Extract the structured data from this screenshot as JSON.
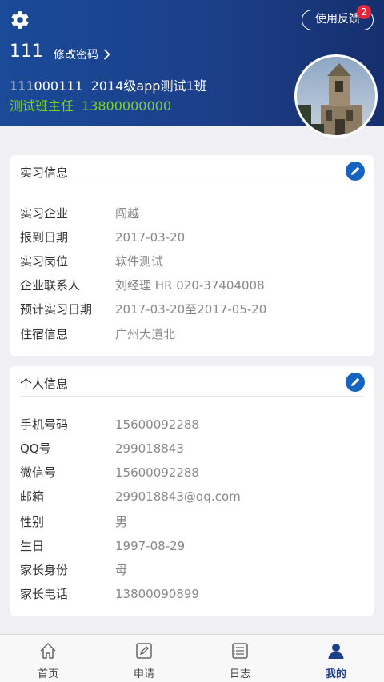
{
  "header": {
    "username": "111",
    "change_password": "修改密码",
    "feedback_label": "使用反馈",
    "feedback_badge": "2",
    "student_id": "111000111",
    "class_name": "2014级app测试1班",
    "teacher_title": "测试班主任",
    "teacher_phone": "13800000000"
  },
  "internship": {
    "title": "实习信息",
    "rows": [
      {
        "label": "实习企业",
        "value": "闯越"
      },
      {
        "label": "报到日期",
        "value": "2017-03-20"
      },
      {
        "label": "实习岗位",
        "value": "软件测试"
      },
      {
        "label": "企业联系人",
        "value": "刘经理 HR 020-37404008"
      },
      {
        "label": "预计实习日期",
        "value": "2017-03-20至2017-05-20"
      },
      {
        "label": "住宿信息",
        "value": "广州大道北"
      }
    ]
  },
  "personal": {
    "title": "个人信息",
    "rows": [
      {
        "label": "手机号码",
        "value": "15600092288"
      },
      {
        "label": "QQ号",
        "value": "299018843"
      },
      {
        "label": "微信号",
        "value": "15600092288"
      },
      {
        "label": "邮箱",
        "value": "299018843@qq.com"
      },
      {
        "label": "性别",
        "value": "男"
      },
      {
        "label": "生日",
        "value": "1997-08-29"
      },
      {
        "label": "家长身份",
        "value": "母"
      },
      {
        "label": "家长电话",
        "value": "13800090899"
      }
    ]
  },
  "tabs": [
    {
      "label": "首页",
      "icon": "home-icon"
    },
    {
      "label": "申请",
      "icon": "edit-doc-icon"
    },
    {
      "label": "日志",
      "icon": "log-icon"
    },
    {
      "label": "我的",
      "icon": "user-icon",
      "active": true
    }
  ],
  "colors": {
    "header_bg": "#1c3f8a",
    "teacher_text": "#7ed321",
    "badge": "#e8253a",
    "edit_button": "#1565c0"
  }
}
